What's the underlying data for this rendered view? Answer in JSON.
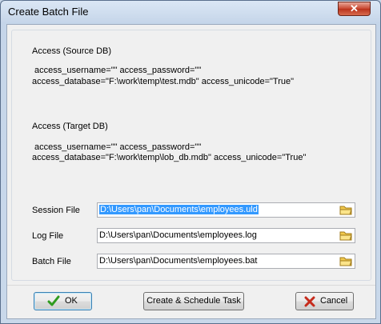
{
  "window": {
    "title": "Create Batch File",
    "close_glyph": "✕"
  },
  "source": {
    "heading": "Access (Source DB)",
    "line1": "access_username=\"\" access_password=\"\"",
    "line2": "access_database=\"F:\\work\\temp\\test.mdb\" access_unicode=\"True\""
  },
  "target": {
    "heading": "Access (Target DB)",
    "line1": "access_username=\"\" access_password=\"\"",
    "line2": "access_database=\"F:\\work\\temp\\lob_db.mdb\" access_unicode=\"True\""
  },
  "files": {
    "session_label": "Session File",
    "session_value": "D:\\Users\\pan\\Documents\\employees.uld",
    "log_label": "Log File",
    "log_value": "D:\\Users\\pan\\Documents\\employees.log",
    "batch_label": "Batch File",
    "batch_value": "D:\\Users\\pan\\Documents\\employees.bat"
  },
  "buttons": {
    "ok": "OK",
    "schedule": "Create & Schedule Task",
    "cancel": "Cancel"
  },
  "colors": {
    "selection": "#3399ff",
    "ok_check": "#2e9b1e",
    "cancel_x": "#c62b1c",
    "folder": "#f2c94c"
  }
}
